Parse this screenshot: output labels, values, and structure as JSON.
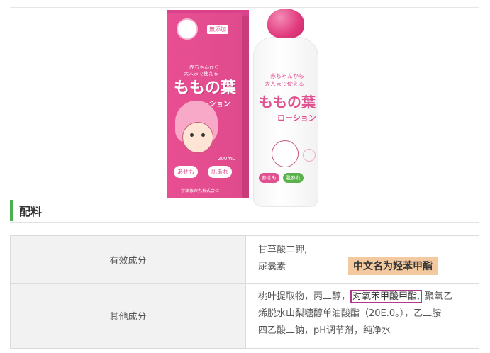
{
  "product_image": {
    "box": {
      "badge": "無添加",
      "tagline_1": "赤ちゃんから",
      "tagline_2": "大人まで使える",
      "brand": "ももの葉",
      "subtitle": "ローション",
      "volume": "200mL",
      "pill_1": "あせも",
      "pill_2": "肌あれ",
      "maker": "宇津救命丸株式会社"
    },
    "bottle": {
      "tagline_1": "赤ちゃんから",
      "tagline_2": "大人まで使える",
      "brand": "ももの葉",
      "subtitle": "ローション",
      "pill_1": "あせも",
      "pill_2": "肌あれ"
    }
  },
  "section": {
    "title": "配料"
  },
  "table": {
    "rows": [
      {
        "label": "有效成分",
        "lines": [
          "甘草酸二钾,",
          "尿囊素"
        ]
      },
      {
        "label": "其他成分",
        "line1_before": "桃叶提取物，丙二醇，",
        "line1_boxed": "对氧苯甲酸甲酯,",
        "line1_after": "聚氧乙",
        "line2": "烯脱水山梨糖醇单油酸酯（20E.0。），乙二胺",
        "line3": "四乙酸二钠，pH调节剂，纯净水"
      }
    ]
  },
  "callout": {
    "text": "中文名为羟苯甲酯"
  },
  "colors": {
    "accent_green": "#4caf50",
    "highlight_box": "#b0378f",
    "callout_bg": "#f3c9a0"
  }
}
